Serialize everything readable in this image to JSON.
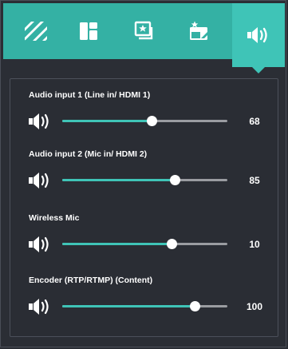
{
  "toolbar": {
    "tabs": [
      {
        "icon": "stripes-icon",
        "active": false
      },
      {
        "icon": "layout-icon",
        "active": false
      },
      {
        "icon": "image-star-icon",
        "active": false
      },
      {
        "icon": "window-star-icon",
        "active": false
      },
      {
        "icon": "speaker-icon",
        "active": true
      }
    ]
  },
  "audio": {
    "channels": [
      {
        "label": "Audio input 1 (Line in/ HDMI 1)",
        "value": "68",
        "level": 0.54
      },
      {
        "label": "Audio input 2 (Mic in/ HDMI 2)",
        "value": "85",
        "level": 0.68
      },
      {
        "label": "Wireless Mic",
        "value": "10",
        "level": 0.66
      },
      {
        "label": "Encoder (RTP/RTMP) (Content)",
        "value": "100",
        "level": 0.8
      }
    ]
  },
  "colors": {
    "accent": "#34b1a4",
    "accent_active": "#3fc4b7",
    "panel_bg": "#2a2d34",
    "track": "#9a9ca1"
  }
}
